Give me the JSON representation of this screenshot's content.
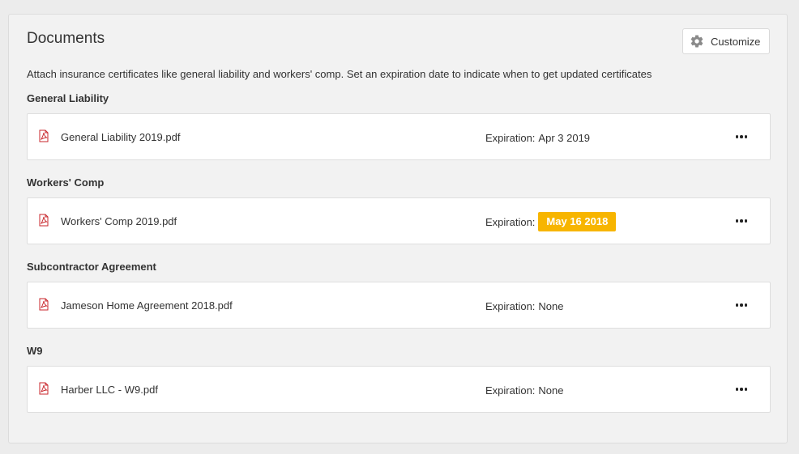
{
  "page": {
    "title": "Documents",
    "description": "Attach insurance certificates like general liability and workers' comp. Set an expiration date to indicate when to get updated certificates",
    "customize_label": "Customize"
  },
  "colors": {
    "badge_warning": "#f7b500",
    "pdf_red": "#c8262b"
  },
  "sections": [
    {
      "title": "General Liability",
      "document": {
        "file_name": "General Liability 2019.pdf",
        "icon": "pdf-icon",
        "expiration_label": "Expiration:",
        "expiration_value": "Apr 3 2019",
        "expiration_highlight": false
      }
    },
    {
      "title": "Workers' Comp",
      "document": {
        "file_name": "Workers' Comp 2019.pdf",
        "icon": "pdf-icon",
        "expiration_label": "Expiration:",
        "expiration_value": "May 16 2018",
        "expiration_highlight": true
      }
    },
    {
      "title": "Subcontractor Agreement",
      "document": {
        "file_name": "Jameson Home Agreement 2018.pdf",
        "icon": "pdf-icon",
        "expiration_label": "Expiration:",
        "expiration_value": "None",
        "expiration_highlight": false
      }
    },
    {
      "title": "W9",
      "document": {
        "file_name": "Harber LLC - W9.pdf",
        "icon": "pdf-icon",
        "expiration_label": "Expiration:",
        "expiration_value": "None",
        "expiration_highlight": false
      }
    }
  ]
}
